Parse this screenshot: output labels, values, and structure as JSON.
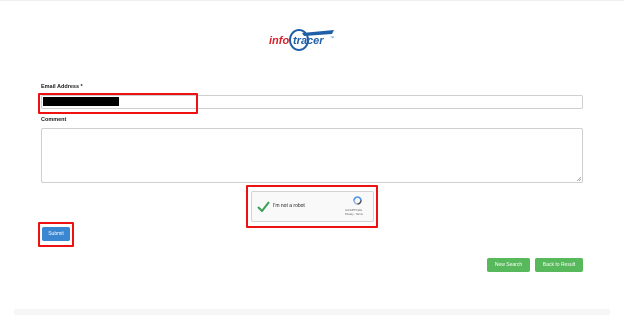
{
  "header": {
    "logo_text_left": "info",
    "logo_text_right": "tracer",
    "logo_trademark": "™"
  },
  "form": {
    "email_label": "Email Address *",
    "email_value": "",
    "comment_label": "Comment",
    "comment_value": ""
  },
  "captcha": {
    "label": "I'm not a robot",
    "brand": "reCAPTCHA",
    "links": "Privacy - Terms",
    "checked": true
  },
  "buttons": {
    "submit": "Submit",
    "new_search": "New Search",
    "back_to_result": "Back to Result"
  },
  "colors": {
    "highlight": "#e11111",
    "submit_blue": "#3a86d1",
    "green_buttons": "#58b85c",
    "logo_red": "#d6212a",
    "logo_blue": "#1f5fa8"
  }
}
